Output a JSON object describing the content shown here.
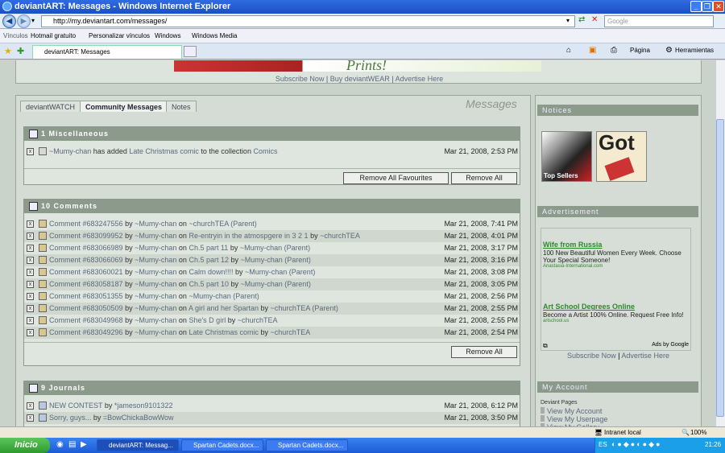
{
  "window": {
    "title": "deviantART: Messages - Windows Internet Explorer"
  },
  "address": {
    "url": "http://my.deviantart.com/messages/",
    "search_placeholder": "Google"
  },
  "links_bar": {
    "label": "Vínculos",
    "items": [
      "Hotmail gratuito",
      "Personalizar vínculos",
      "Windows",
      "Windows Media"
    ]
  },
  "browser_tab": {
    "title": "deviantART: Messages"
  },
  "toolbar": {
    "page": "Página",
    "tools": "Herramientas"
  },
  "banner": {
    "text": "Prints!",
    "links": [
      "Subscribe Now",
      "Buy deviantWEAR",
      "Advertise Here"
    ]
  },
  "tabs": [
    "deviantWATCH",
    "Community Messages",
    "Notes"
  ],
  "heading": "Messages",
  "misc": {
    "title": "1 Miscellaneous",
    "row": {
      "user": "~Mumy-chan",
      "action": "has added",
      "item": "Late Christmas comic",
      "mid": "to the collection",
      "collection": "Comics",
      "date": "Mar 21, 2008, 2:53 PM"
    },
    "buttons": [
      "Remove All Favourites",
      "Remove All"
    ]
  },
  "comments": {
    "title": "10 Comments",
    "rows": [
      {
        "cid": "Comment #683247556",
        "by": "~Mumy-chan",
        "target": "~churchTEA (Parent)",
        "tby": "",
        "date": "Mar 21, 2008, 7:41 PM"
      },
      {
        "cid": "Comment #683099952",
        "by": "~Mumy-chan",
        "target": "Re-entryin in the atmospgere in 3 2 1",
        "tby": "~churchTEA",
        "date": "Mar 21, 2008, 4:01 PM"
      },
      {
        "cid": "Comment #683066989",
        "by": "~Mumy-chan",
        "target": "Ch.5 part 11",
        "tby": "~Mumy-chan (Parent)",
        "date": "Mar 21, 2008, 3:17 PM"
      },
      {
        "cid": "Comment #683066069",
        "by": "~Mumy-chan",
        "target": "Ch.5 part 12",
        "tby": "~Mumy-chan (Parent)",
        "date": "Mar 21, 2008, 3:16 PM"
      },
      {
        "cid": "Comment #683060021",
        "by": "~Mumy-chan",
        "target": "Calm down!!!!",
        "tby": "~Mumy-chan (Parent)",
        "date": "Mar 21, 2008, 3:08 PM"
      },
      {
        "cid": "Comment #683058187",
        "by": "~Mumy-chan",
        "target": "Ch.5 part 10",
        "tby": "~Mumy-chan (Parent)",
        "date": "Mar 21, 2008, 3:05 PM"
      },
      {
        "cid": "Comment #683051355",
        "by": "~Mumy-chan",
        "target": "~Mumy-chan (Parent)",
        "tby": "",
        "date": "Mar 21, 2008, 2:56 PM"
      },
      {
        "cid": "Comment #683050509",
        "by": "~Mumy-chan",
        "target": "A girl and her Spartan",
        "tby": "~churchTEA (Parent)",
        "date": "Mar 21, 2008, 2:55 PM"
      },
      {
        "cid": "Comment #683049968",
        "by": "~Mumy-chan",
        "target": "She's D girl",
        "tby": "~churchTEA",
        "date": "Mar 21, 2008, 2:55 PM"
      },
      {
        "cid": "Comment #683049296",
        "by": "~Mumy-chan",
        "target": "Late Christmas comic",
        "tby": "~churchTEA",
        "date": "Mar 21, 2008, 2:54 PM"
      }
    ],
    "remove_all": "Remove All"
  },
  "journals": {
    "title": "9 Journals",
    "rows": [
      {
        "title": "NEW CONTEST",
        "by": "*jameson9101322",
        "date": "Mar 21, 2008, 6:12 PM"
      },
      {
        "title": "Sorry, guys...",
        "by": "=BowChickaBowWow",
        "date": "Mar 21, 2008, 3:50 PM"
      }
    ]
  },
  "words": {
    "by": "by",
    "on": "on"
  },
  "side": {
    "notices": "Notices",
    "thumb1": "Top Sellers",
    "thumb2": "Got",
    "advertisement": "Advertisement",
    "ads": [
      {
        "title": "Wife from Russia",
        "desc": "100 New Beautiful Women Every Week. Choose Your Special Someone!",
        "url": "Anastasia-International.com"
      },
      {
        "title": "Art School Degrees Online",
        "desc": "Become a Artist 100% Online. Request Free Info!",
        "url": "artschool.us"
      }
    ],
    "ads_by": "Ads by Google",
    "ad_links": [
      "Subscribe Now",
      "Advertise Here"
    ],
    "my_account": "My Account",
    "deviant_pages": "Deviant Pages",
    "account_links": [
      "View My Account",
      "View My Userpage",
      "View My Gallery"
    ]
  },
  "status": {
    "zone": "Intranet local",
    "zoom": "100%"
  },
  "taskbar": {
    "start": "Inicio",
    "tasks": [
      "deviantART: Messag...",
      "Spartan Cadets.docx...",
      "Spartan Cadets.docx..."
    ],
    "lang": "ES",
    "time": "21:26"
  }
}
